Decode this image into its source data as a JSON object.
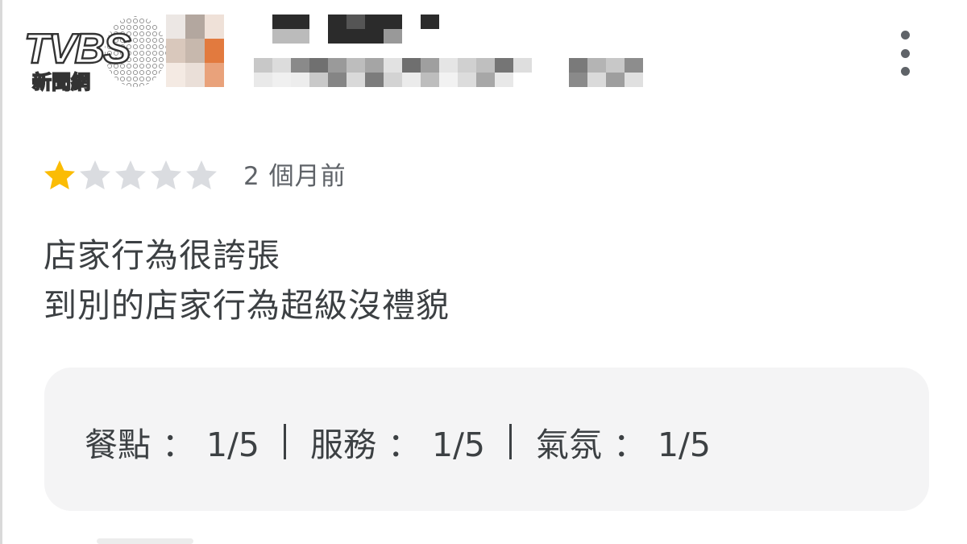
{
  "watermark": {
    "brand": "TVBS",
    "subtitle": "新聞網"
  },
  "header": {
    "avatar": "blurred avatar",
    "more_icon": "more-vert-icon"
  },
  "review": {
    "rating": 1,
    "max_rating": 5,
    "time_ago": "2 個月前",
    "lines": [
      "店家行為很誇張",
      "到別的店家行為超級沒禮貌"
    ],
    "sub_ratings": [
      {
        "label": "餐點",
        "value": "1/5"
      },
      {
        "label": "服務",
        "value": "1/5"
      },
      {
        "label": "氣氛",
        "value": "1/5"
      }
    ],
    "colon": "："
  },
  "colors": {
    "star_filled": "#fbbc04",
    "star_empty": "#dadce0",
    "text": "#3c4043",
    "muted": "#5f6368",
    "card_bg": "#f4f4f5"
  }
}
